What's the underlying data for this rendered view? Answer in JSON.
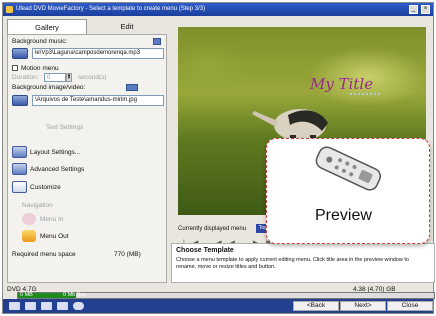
{
  "window": {
    "title": "Ulead DVD MovieFactory - Select a template to create menu (Step 3/3)",
    "min_label": "_",
    "close_label": "×"
  },
  "tabs": [
    {
      "label": "Gallery"
    },
    {
      "label": "Edit"
    }
  ],
  "edit": {
    "background_music_label": "Background music:",
    "background_music_path": "le\\Vp3\\Laguna\\camposdemorenqa.mp3",
    "motion_menu_label": "Motion menu",
    "duration_label": "Duration:",
    "duration_value": "0",
    "duration_unit": "second(s)",
    "background_image_label": "Background image/video:",
    "background_image_path": "\\Arquivos de Teste\\amandus-mirim.jpg",
    "text_settings_label": "Text Settings",
    "layout_settings_label": "Layout Settings...",
    "advanced_settings_label": "Advanced Settings",
    "customize_label": "Customize",
    "navigation_label": "Navigation",
    "menu_in_label": "Menu In",
    "menu_out_label": "Menu Out",
    "required_space_label": "Required menu space",
    "required_space_value": "770 (MB)"
  },
  "preview": {
    "video_title": "My Title",
    "overlay_label": "Preview",
    "current_menu_label": "Currently displayed menu",
    "current_menu_value": "Top",
    "transport_controls": "|◀  ◀◀  ▶▶|  ▶|"
  },
  "template": {
    "heading": "Choose Template",
    "description": "Choose a menu template to apply current editing menu. Click title area in the preview window to rename, move or resize titles and button."
  },
  "status": {
    "disc_type": "DVD 4.7G",
    "capacity_start": "0 MB",
    "capacity_used": "0 Mb Sec",
    "capacity_total": "4.38 (4.70) GB",
    "capacity_fraction": 0.14
  },
  "buttons": {
    "back": "<Back",
    "next": "Next>",
    "close": "Close"
  },
  "colors": {
    "titlebar": "#2f5cc9",
    "accent": "#233f8f",
    "overlay_border": "#d13c3c",
    "menu_title": "#9a2a8f"
  }
}
